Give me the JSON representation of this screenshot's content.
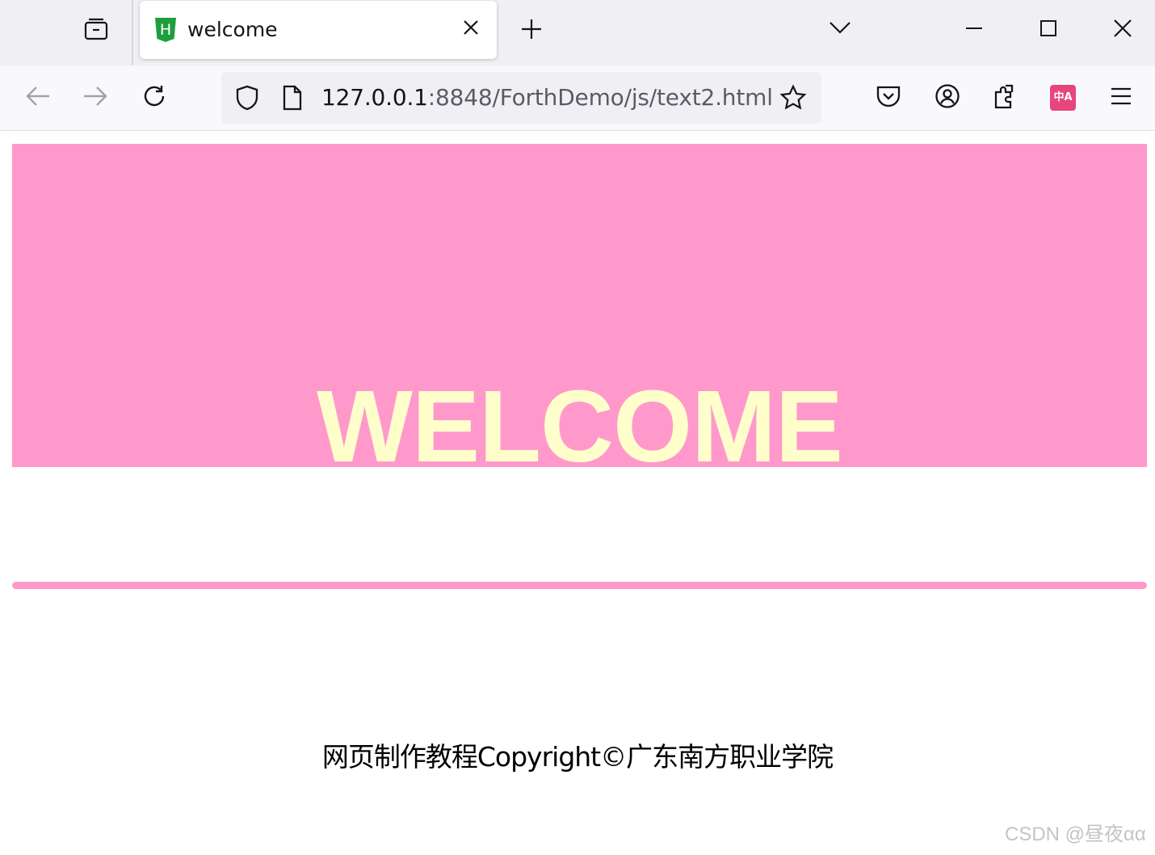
{
  "browser": {
    "tab": {
      "title": "welcome",
      "favicon": "html5-icon",
      "favicon_letter": "H"
    },
    "address_bar": {
      "host": "127.0.0.1",
      "path": ":8848/ForthDemo/js/text2.html"
    },
    "toolbar": {
      "translate_badge": "中A"
    }
  },
  "page": {
    "banner_title": "WELCOME",
    "footer_text": "网页制作教程Copyright©广东南方职业学院"
  },
  "watermark": "CSDN @昼夜αα",
  "colors": {
    "banner_background": "#ff99cc",
    "banner_text": "#ffffcc",
    "divider": "#ff99cc",
    "favicon": "#1e9e3e",
    "translate_badge": "#e8457e"
  }
}
